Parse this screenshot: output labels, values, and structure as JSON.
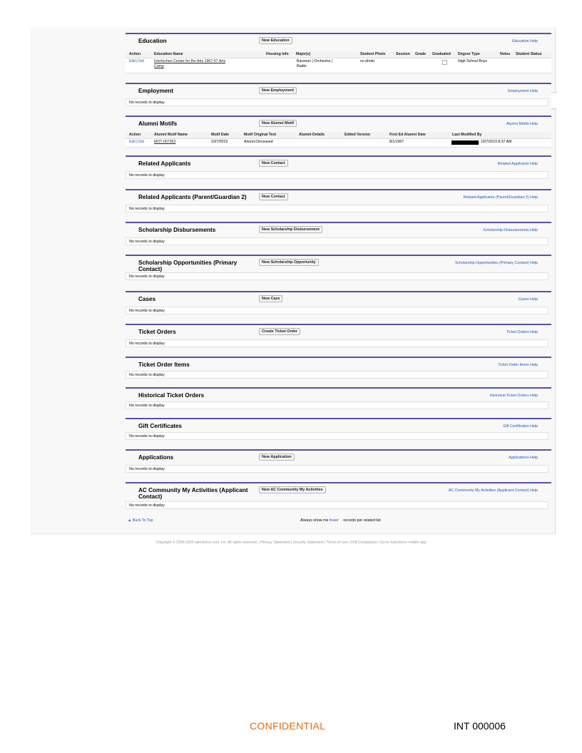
{
  "education": {
    "title": "Education",
    "new_button": "New Education",
    "help": "Education Help",
    "headers": [
      "Action",
      "Education Name",
      "Housing Info",
      "Major(s)",
      "Student Photo",
      "Session",
      "Grade",
      "Graduated",
      "Degree Type",
      "Notes",
      "Student Status"
    ],
    "row": {
      "edit": "Edit",
      "sep": "|",
      "del": "Del",
      "name_line1": "Interlochen Center for the Arts 1967-67 Arts",
      "name_line2": "Camp",
      "majors_line1": "Bassoon | Orchestra |",
      "majors_line2": "Radio",
      "student_photo": "no photo",
      "degree_type": "High School Boys"
    }
  },
  "employment": {
    "title": "Employment",
    "new_button": "New Employment",
    "help": "Employment Help",
    "empty": "No records to display"
  },
  "alumni_motifs": {
    "title": "Alumni Motifs",
    "new_button": "New Alumni Motif",
    "help": "Alumni Motifs Help",
    "headers": [
      "Action",
      "Alumni Motif Name",
      "Motif Date",
      "Motif Original Text",
      "Alumni Details",
      "Edited Version",
      "First Ed Alumni Date",
      "Last Modified By"
    ],
    "row": {
      "edit": "Edit",
      "sep": "|",
      "del": "Del",
      "name": "MOT-007363",
      "motif_date": "10/7/2019",
      "original_text": "Alumni Deceased",
      "first_ed_date": "8/1/1967",
      "last_modified": ", 10/7/2019 8:37 AM"
    }
  },
  "related_applicants": {
    "title": "Related Applicants",
    "new_button": "New Contact",
    "help": "Related Applicants Help",
    "empty": "No records to display"
  },
  "related_applicants_2": {
    "title": "Related Applicants (Parent/Guardian 2)",
    "new_button": "New Contact",
    "help": "Related Applicants (Parent/Guardian 2) Help",
    "empty": "No records to display"
  },
  "scholarship_disbursements": {
    "title": "Scholarship Disbursements",
    "new_button": "New Scholarship Disbursement",
    "help": "Scholarship Disbursements Help",
    "empty": "No records to display"
  },
  "scholarship_opportunities": {
    "title_line1": "Scholarship Opportunities (Primary",
    "title_line2": "Contact)",
    "new_button": "New Scholarship Opportunity",
    "help": "Scholarship Opportunities (Primary Contact) Help",
    "empty": "No records to display"
  },
  "cases": {
    "title": "Cases",
    "new_button": "New Case",
    "help": "Cases Help",
    "empty": "No records to display"
  },
  "ticket_orders": {
    "title": "Ticket Orders",
    "new_button": "Create Ticket Order",
    "help": "Ticket Orders Help",
    "empty": "No records to display"
  },
  "ticket_order_items": {
    "title": "Ticket Order Items",
    "help": "Ticket Order Items Help",
    "empty": "No records to display"
  },
  "historical_ticket_orders": {
    "title": "Historical Ticket Orders",
    "help": "Historical Ticket Orders Help",
    "empty": "No records to display"
  },
  "gift_certificates": {
    "title": "Gift Certificates",
    "help": "Gift Certificates Help",
    "empty": "No records to display"
  },
  "applications": {
    "title": "Applications",
    "new_button": "New Application",
    "help": "Applications Help",
    "empty": "No records to display"
  },
  "ac_community": {
    "title_line1": "AC Community My Activities (Applicant",
    "title_line2": "Contact)",
    "new_button": "New AC Community My Activities",
    "help": "AC Community My Activities (Applicant Contact) Help",
    "empty": "No records to display"
  },
  "footer": {
    "back_to_top": "Back To Top",
    "show_prefix": "Always show me",
    "fewer_link": "fewer",
    "show_suffix": "records per related list"
  },
  "copyright": "Copyright © 2000-2020 salesforce.com, inc. All rights reserved. | Privacy Statement | Security Statement | Terms of Use | 508 Compliance | Go to Salesforce mobile app",
  "stamps": {
    "confidential": "CONFIDENTIAL",
    "bates": "INT 000006"
  },
  "colors": {
    "section_rule": "#5a4fa2",
    "link": "#1a5bb5",
    "confidential": "#e36c0a"
  }
}
